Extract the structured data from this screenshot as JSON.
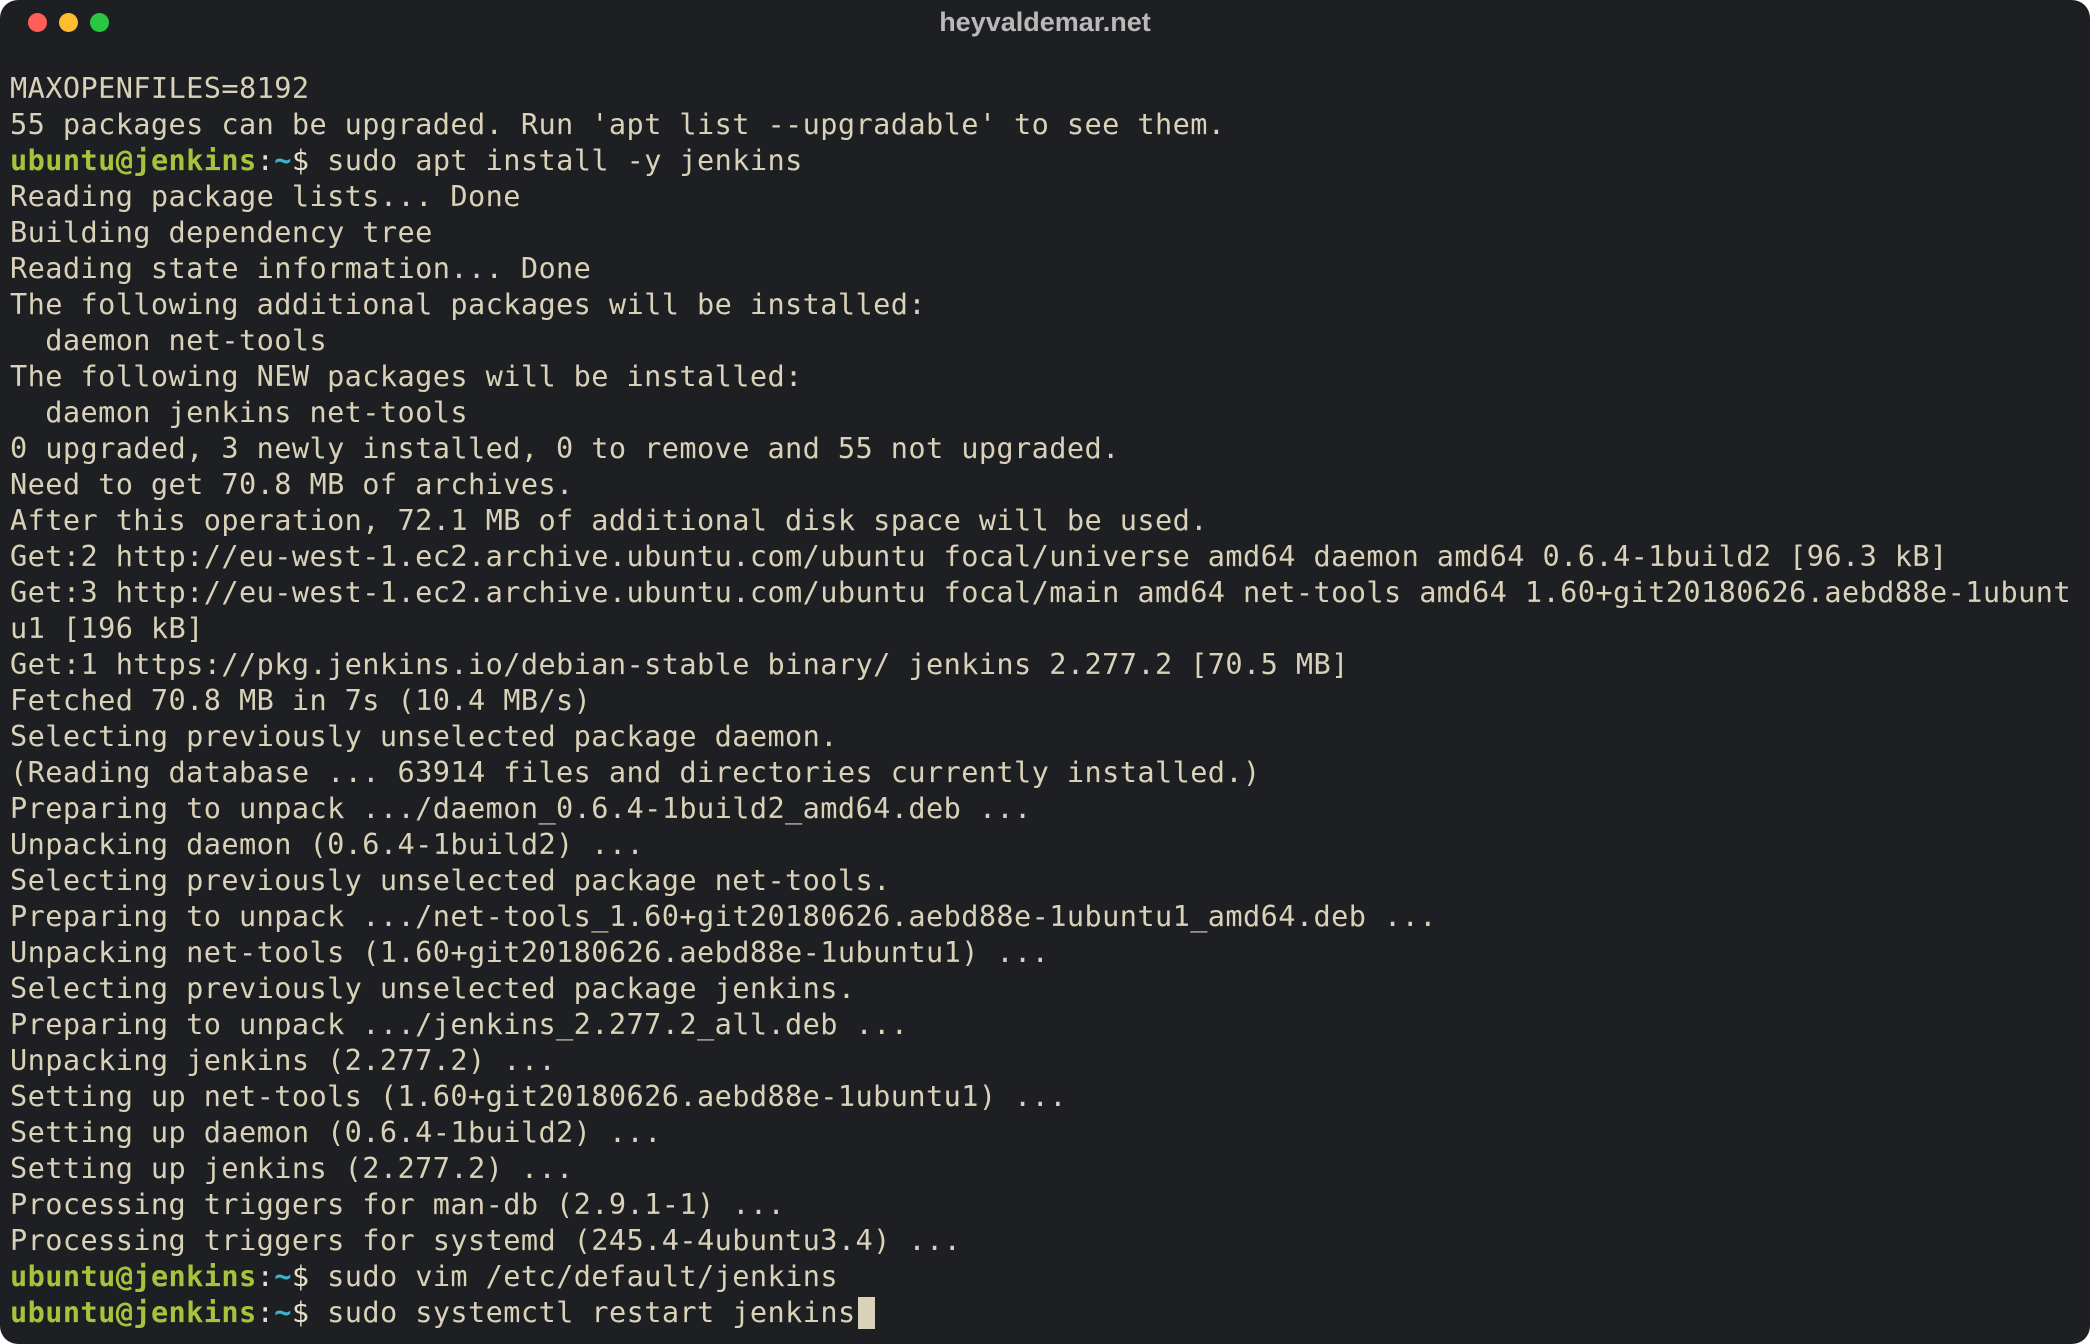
{
  "window": {
    "title": "heyvaldemar.net"
  },
  "prompt": {
    "user": "ubuntu",
    "host": "jenkins",
    "sep1": "@",
    "sep2": ":",
    "path": "~",
    "symbol": "$"
  },
  "lines": {
    "l0": "MAXOPENFILES=8192",
    "l1": "55 packages can be upgraded. Run 'apt list --upgradable' to see them.",
    "cmd1": " sudo apt install -y jenkins",
    "l3": "Reading package lists... Done",
    "l4": "Building dependency tree",
    "l5": "Reading state information... Done",
    "l6": "The following additional packages will be installed:",
    "l7": "  daemon net-tools",
    "l8": "The following NEW packages will be installed:",
    "l9": "  daemon jenkins net-tools",
    "l10": "0 upgraded, 3 newly installed, 0 to remove and 55 not upgraded.",
    "l11": "Need to get 70.8 MB of archives.",
    "l12": "After this operation, 72.1 MB of additional disk space will be used.",
    "l13": "Get:2 http://eu-west-1.ec2.archive.ubuntu.com/ubuntu focal/universe amd64 daemon amd64 0.6.4-1build2 [96.3 kB]",
    "l14": "Get:3 http://eu-west-1.ec2.archive.ubuntu.com/ubuntu focal/main amd64 net-tools amd64 1.60+git20180626.aebd88e-1ubuntu1 [196 kB]",
    "l15": "Get:1 https://pkg.jenkins.io/debian-stable binary/ jenkins 2.277.2 [70.5 MB]",
    "l16": "Fetched 70.8 MB in 7s (10.4 MB/s)",
    "l17": "Selecting previously unselected package daemon.",
    "l18": "(Reading database ... 63914 files and directories currently installed.)",
    "l19": "Preparing to unpack .../daemon_0.6.4-1build2_amd64.deb ...",
    "l20": "Unpacking daemon (0.6.4-1build2) ...",
    "l21": "Selecting previously unselected package net-tools.",
    "l22": "Preparing to unpack .../net-tools_1.60+git20180626.aebd88e-1ubuntu1_amd64.deb ...",
    "l23": "Unpacking net-tools (1.60+git20180626.aebd88e-1ubuntu1) ...",
    "l24": "Selecting previously unselected package jenkins.",
    "l25": "Preparing to unpack .../jenkins_2.277.2_all.deb ...",
    "l26": "Unpacking jenkins (2.277.2) ...",
    "l27": "Setting up net-tools (1.60+git20180626.aebd88e-1ubuntu1) ...",
    "l28": "Setting up daemon (0.6.4-1build2) ...",
    "l29": "Setting up jenkins (2.277.2) ...",
    "l30": "Processing triggers for man-db (2.9.1-1) ...",
    "l31": "Processing triggers for systemd (245.4-4ubuntu3.4) ...",
    "cmd2": " sudo vim /etc/default/jenkins",
    "cmd3": " sudo systemctl restart jenkins"
  }
}
